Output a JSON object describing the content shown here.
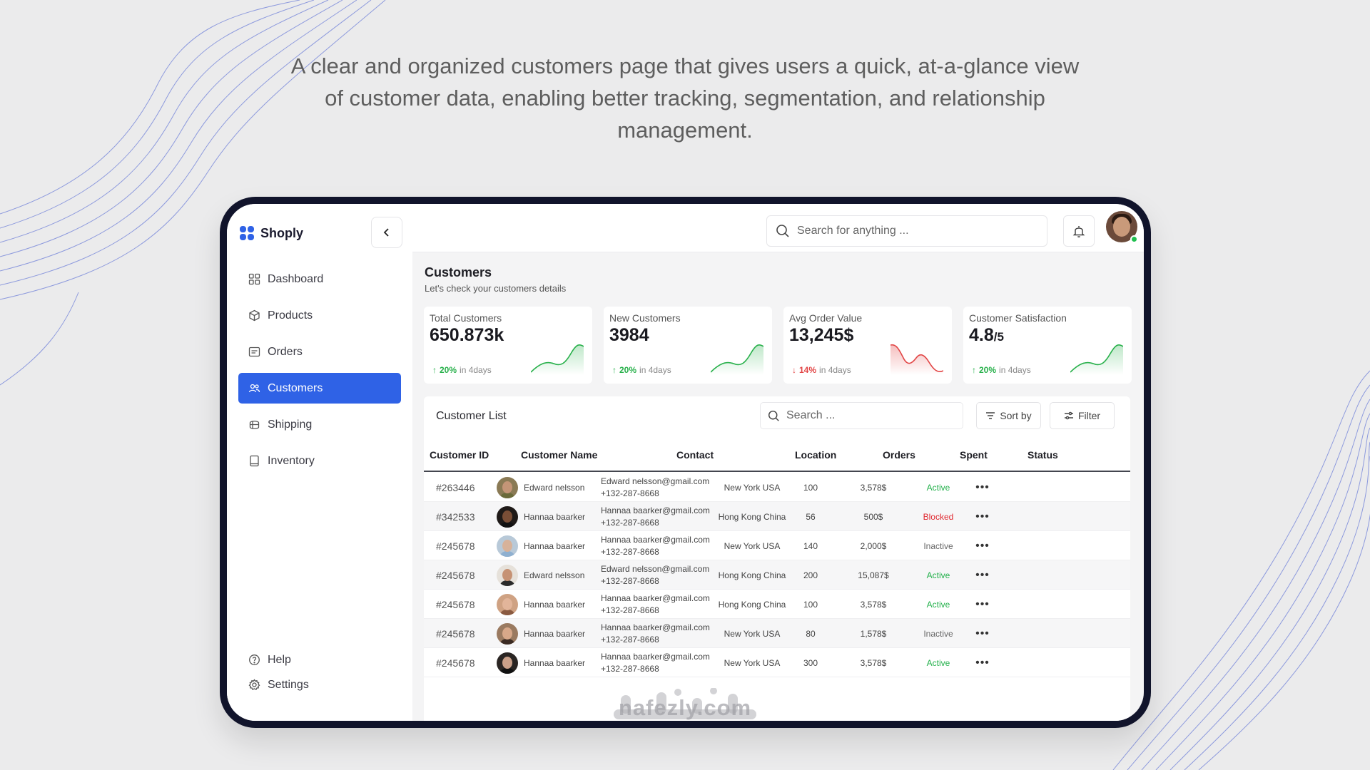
{
  "headline": "A clear and organized customers page that gives users a quick, at-a-glance view of customer data, enabling better tracking, segmentation, and relationship management.",
  "brand": {
    "name": "Shoply",
    "color": "#2f62e6"
  },
  "sidebar": {
    "items": [
      {
        "label": "Dashboard",
        "icon": "dashboard-icon",
        "active": false
      },
      {
        "label": "Products",
        "icon": "box-icon",
        "active": false
      },
      {
        "label": "Orders",
        "icon": "orders-icon",
        "active": false
      },
      {
        "label": "Customers",
        "icon": "users-icon",
        "active": true
      },
      {
        "label": "Shipping",
        "icon": "shipping-icon",
        "active": false
      },
      {
        "label": "Inventory",
        "icon": "inventory-icon",
        "active": false
      }
    ],
    "bottom": [
      {
        "label": "Help",
        "icon": "help-icon"
      },
      {
        "label": "Settings",
        "icon": "gear-icon"
      }
    ]
  },
  "topbar": {
    "search_placeholder": "Search for anything ..."
  },
  "page": {
    "title": "Customers",
    "subtitle": "Let's check your customers details"
  },
  "stats": [
    {
      "label": "Total Customers",
      "value": "650.873k",
      "suffix": "",
      "trend": "20%",
      "direction": "up",
      "period": "in 4days",
      "color": "#27b04a"
    },
    {
      "label": "New Customers",
      "value": "3984",
      "suffix": "",
      "trend": "20%",
      "direction": "up",
      "period": "in 4days",
      "color": "#27b04a"
    },
    {
      "label": "Avg Order Value",
      "value": "13,245$",
      "suffix": "",
      "trend": "14%",
      "direction": "down",
      "period": "in 4days",
      "color": "#e24545"
    },
    {
      "label": "Customer Satisfaction",
      "value": "4.8",
      "suffix": "/5",
      "trend": "20%",
      "direction": "up",
      "period": "in 4days",
      "color": "#27b04a"
    }
  ],
  "customer_list": {
    "title": "Customer List",
    "search_placeholder": "Search ...",
    "sort_label": "Sort by",
    "filter_label": "Filter",
    "columns": [
      "Customer ID",
      "Customer Name",
      "Contact",
      "Location",
      "Orders",
      "Spent",
      "Status"
    ],
    "rows": [
      {
        "id": "#263446",
        "name": "Edward nelsson",
        "email": "Edward nelsson@gmail.com",
        "phone": "+132-287-8668",
        "location": "New York USA",
        "orders": "100",
        "spent": "3,578$",
        "status": "Active"
      },
      {
        "id": "#342533",
        "name": "Hannaa baarker",
        "email": "Hannaa baarker@gmail.com",
        "phone": "+132-287-8668",
        "location": "Hong Kong China",
        "orders": "56",
        "spent": "500$",
        "status": "Blocked"
      },
      {
        "id": "#245678",
        "name": "Hannaa baarker",
        "email": "Hannaa baarker@gmail.com",
        "phone": "+132-287-8668",
        "location": "New York USA",
        "orders": "140",
        "spent": "2,000$",
        "status": "Inactive"
      },
      {
        "id": "#245678",
        "name": "Edward nelsson",
        "email": "Edward nelsson@gmail.com",
        "phone": "+132-287-8668",
        "location": "Hong Kong China",
        "orders": "200",
        "spent": "15,087$",
        "status": "Active"
      },
      {
        "id": "#245678",
        "name": "Hannaa baarker",
        "email": "Hannaa baarker@gmail.com",
        "phone": "+132-287-8668",
        "location": "Hong Kong China",
        "orders": "100",
        "spent": "3,578$",
        "status": "Active"
      },
      {
        "id": "#245678",
        "name": "Hannaa baarker",
        "email": "Hannaa baarker@gmail.com",
        "phone": "+132-287-8668",
        "location": "New York USA",
        "orders": "80",
        "spent": "1,578$",
        "status": "Inactive"
      },
      {
        "id": "#245678",
        "name": "Hannaa baarker",
        "email": "Hannaa baarker@gmail.com",
        "phone": "+132-287-8668",
        "location": "New York USA",
        "orders": "300",
        "spent": "3,578$",
        "status": "Active"
      }
    ]
  },
  "status_colors": {
    "Active": "#22b04a",
    "Blocked": "#e0282f",
    "Inactive": "#666666"
  },
  "watermark": "nafezly.com"
}
